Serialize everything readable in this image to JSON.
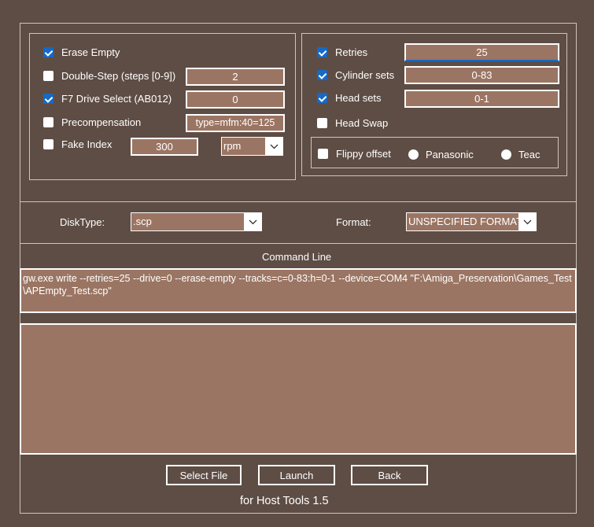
{
  "options_left": {
    "erase_empty": {
      "label": "Erase Empty",
      "checked": true
    },
    "double_step": {
      "label": "Double-Step (steps [0-9])",
      "checked": false,
      "value": "2"
    },
    "f7_drive_select": {
      "label": "F7 Drive Select (AB012)",
      "checked": true,
      "value": "0"
    },
    "precompensation": {
      "label": "Precompensation",
      "checked": false,
      "value": "type=mfm:40=125"
    },
    "fake_index": {
      "label": "Fake Index",
      "checked": false,
      "value": "300",
      "unit": "rpm"
    }
  },
  "options_right": {
    "retries": {
      "label": "Retries",
      "checked": true,
      "value": "25"
    },
    "cylinder_sets": {
      "label": "Cylinder sets",
      "checked": true,
      "value": "0-83"
    },
    "head_sets": {
      "label": "Head sets",
      "checked": true,
      "value": "0-1"
    },
    "head_swap": {
      "label": "Head Swap",
      "checked": false
    },
    "flippy_offset": {
      "label": "Flippy offset",
      "checked": false,
      "radio_panasonic": "Panasonic",
      "radio_teac": "Teac"
    }
  },
  "disk": {
    "disktype_label": "DiskType:",
    "disktype_value": ".scp",
    "format_label": "Format:",
    "format_value": "UNSPECIFIED FORMAT"
  },
  "command": {
    "label": "Command Line",
    "text": "gw.exe write --retries=25 --drive=0 --erase-empty --tracks=c=0-83:h=0-1 --device=COM4 \"F:\\Amiga_Preservation\\Games_Test\\APEmpty_Test.scp\"",
    "output": ""
  },
  "buttons": {
    "select_file": "Select File",
    "launch": "Launch",
    "back": "Back"
  },
  "footer": "for Host Tools 1.5",
  "colors": {
    "background": "#5e4d45",
    "field": "#9b7563",
    "accent": "#1669c6"
  },
  "icons": {
    "checkmark": "checkmark-icon",
    "dropdown": "chevron-down-icon"
  }
}
